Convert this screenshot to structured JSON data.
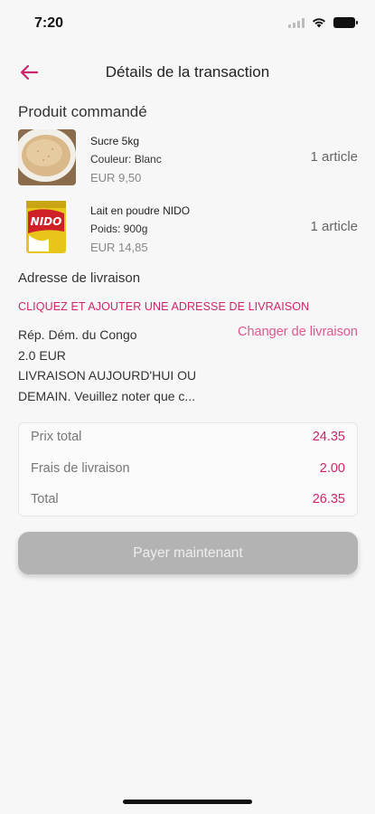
{
  "status_bar": {
    "time": "7:20"
  },
  "header": {
    "title": "Détails de la transaction"
  },
  "products_section": {
    "title": "Produit commandé"
  },
  "products": [
    {
      "name": "Sucre 5kg",
      "attribute": "Couleur: Blanc",
      "price": "EUR 9,50",
      "quantity": "1 article"
    },
    {
      "name": "Lait en poudre NIDO",
      "attribute": "Poids: 900g",
      "price": "EUR 14,85",
      "quantity": "1 article"
    }
  ],
  "delivery": {
    "label": "Adresse de livraison",
    "add_link": "CLIQUEZ ET AJOUTER UNE ADRESSE DE LIVRAISON",
    "country": "Rép. Dém. du Congo",
    "change_link": "Changer de livraison",
    "fee": "2.0 EUR",
    "note_line1": "LIVRAISON AUJOURD'HUI OU",
    "note_line2": "DEMAIN. Veuillez noter que c..."
  },
  "summary": {
    "rows": [
      {
        "label": "Prix total",
        "value": "24.35"
      },
      {
        "label": "Frais de livraison",
        "value": "2.00"
      },
      {
        "label": "Total",
        "value": "26.35"
      }
    ]
  },
  "actions": {
    "pay_label": "Payer maintenant"
  },
  "colors": {
    "accent": "#d0256a",
    "button_disabled": "#b3b3b3"
  },
  "icons": {
    "back": "arrow-left-icon",
    "wifi": "wifi-icon",
    "battery": "battery-icon",
    "signal": "signal-icon"
  }
}
